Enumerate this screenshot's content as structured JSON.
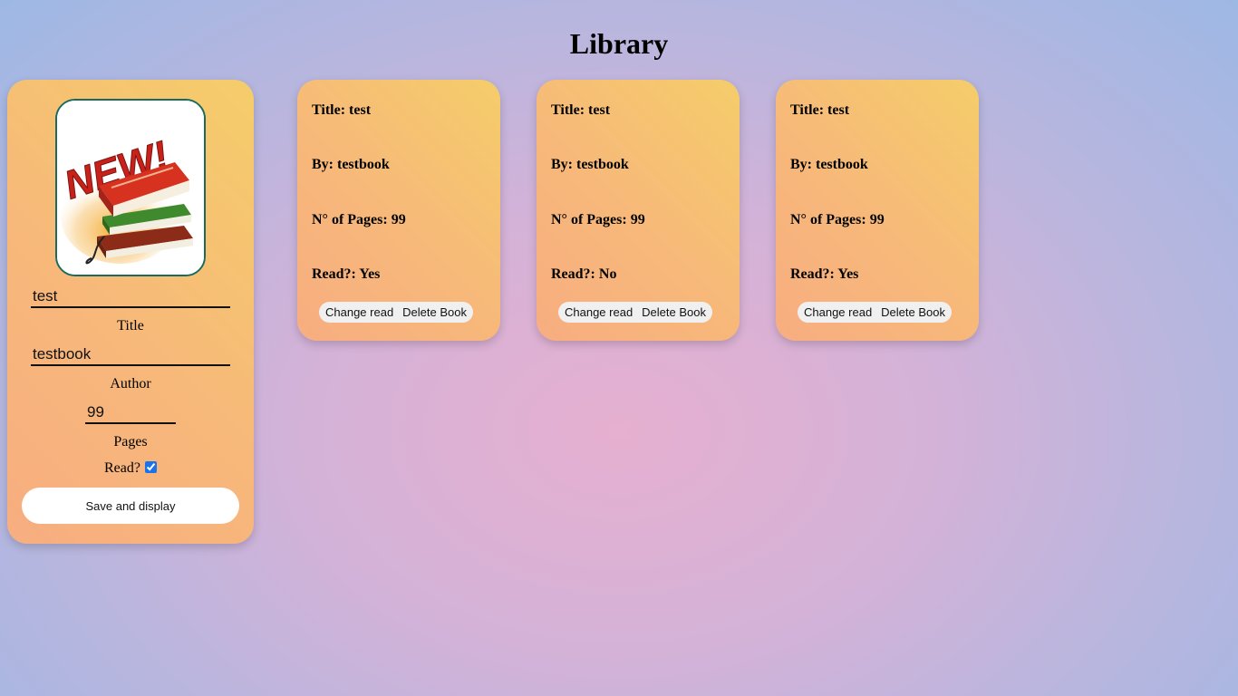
{
  "page": {
    "title": "Library"
  },
  "form": {
    "cover_icon": "new-books-image",
    "title_value": "test",
    "title_label": "Title",
    "author_value": "testbook",
    "author_label": "Author",
    "pages_value": "99",
    "pages_label": "Pages",
    "read_label": "Read?",
    "read_checked": true,
    "save_label": "Save and display"
  },
  "books": [
    {
      "title": "Title: test",
      "author": "By: testbook",
      "pages": "N° of Pages: 99",
      "read": "Read?: Yes",
      "change_label": "Change read",
      "delete_label": "Delete Book"
    },
    {
      "title": "Title: test",
      "author": "By: testbook",
      "pages": "N° of Pages: 99",
      "read": "Read?: No",
      "change_label": "Change read",
      "delete_label": "Delete Book"
    },
    {
      "title": "Title: test",
      "author": "By: testbook",
      "pages": "N° of Pages: 99",
      "read": "Read?: Yes",
      "change_label": "Change read",
      "delete_label": "Delete Book"
    }
  ],
  "colors": {
    "card_gradient_start": "#f5cd6a",
    "card_gradient_end": "#f7ad80",
    "cover_border": "#1a6b5e",
    "background_center": "#e6b0d0",
    "background_edge": "#98b8e6"
  }
}
